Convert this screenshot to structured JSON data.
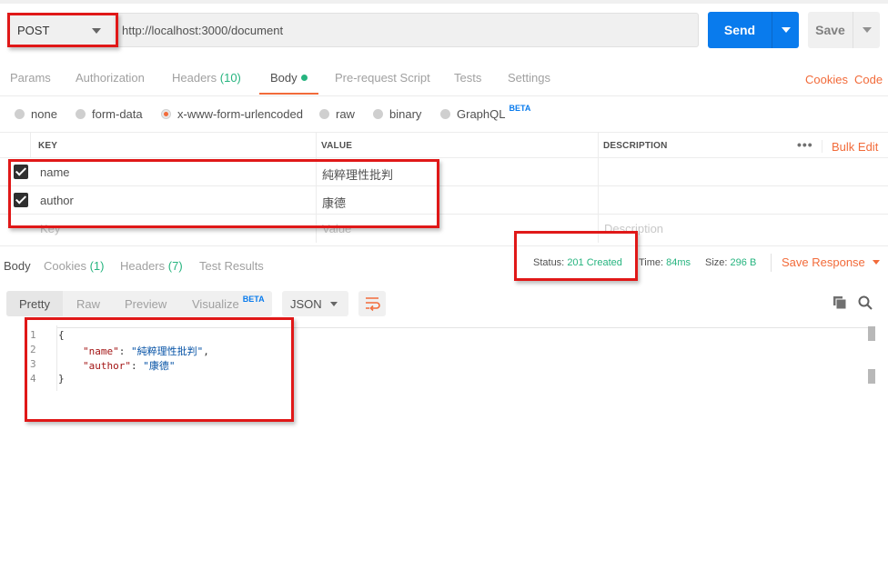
{
  "request": {
    "method": "POST",
    "url": "http://localhost:3000/document",
    "send_label": "Send",
    "save_label": "Save"
  },
  "request_tabs": [
    {
      "label": "Params",
      "count": ""
    },
    {
      "label": "Authorization",
      "count": ""
    },
    {
      "label": "Headers",
      "count": "(10)"
    },
    {
      "label": "Body",
      "count": ""
    },
    {
      "label": "Pre-request Script",
      "count": ""
    },
    {
      "label": "Tests",
      "count": ""
    },
    {
      "label": "Settings",
      "count": ""
    }
  ],
  "request_links": {
    "cookies": "Cookies",
    "code": "Code"
  },
  "body_types": [
    {
      "label": "none",
      "selected": false
    },
    {
      "label": "form-data",
      "selected": false
    },
    {
      "label": "x-www-form-urlencoded",
      "selected": true
    },
    {
      "label": "raw",
      "selected": false
    },
    {
      "label": "binary",
      "selected": false
    },
    {
      "label": "GraphQL",
      "selected": false,
      "badge": "BETA"
    }
  ],
  "kv_table": {
    "headers": {
      "key": "KEY",
      "value": "VALUE",
      "description": "DESCRIPTION"
    },
    "more": "•••",
    "bulk_edit": "Bulk Edit",
    "rows": [
      {
        "checked": true,
        "key": "name",
        "value": "純粹理性批判",
        "description": ""
      },
      {
        "checked": true,
        "key": "author",
        "value": "康德",
        "description": ""
      }
    ],
    "placeholder": {
      "key": "Key",
      "value": "Value",
      "description": "Description"
    }
  },
  "response_tabs": [
    {
      "label": "Body",
      "count": ""
    },
    {
      "label": "Cookies",
      "count": "(1)"
    },
    {
      "label": "Headers",
      "count": "(7)"
    },
    {
      "label": "Test Results",
      "count": ""
    }
  ],
  "response_meta": {
    "status_label": "Status:",
    "status_value": "201 Created",
    "time_label": "Time:",
    "time_value": "84ms",
    "size_label": "Size:",
    "size_value": "296 B",
    "save_response": "Save Response"
  },
  "view_modes": [
    {
      "label": "Pretty",
      "badge": ""
    },
    {
      "label": "Raw",
      "badge": ""
    },
    {
      "label": "Preview",
      "badge": ""
    },
    {
      "label": "Visualize",
      "badge": "BETA"
    }
  ],
  "format_select": "JSON",
  "code": {
    "line_numbers": [
      "1",
      "2",
      "3",
      "4"
    ],
    "open_brace": "{",
    "close_brace": "}",
    "lines": [
      {
        "key": "\"name\"",
        "sep": ": ",
        "value": "\"純粹理性批判\"",
        "trail": ","
      },
      {
        "key": "\"author\"",
        "sep": ": ",
        "value": "\"康德\"",
        "trail": ""
      }
    ]
  },
  "colors": {
    "accent": "#f26b3a",
    "primary": "#097bed",
    "success": "#26b47f",
    "annotation": "#e01818"
  }
}
